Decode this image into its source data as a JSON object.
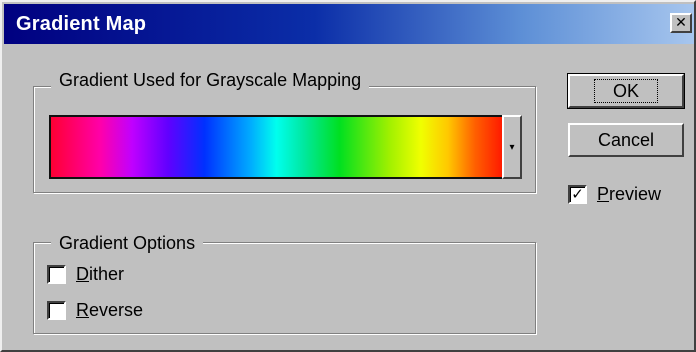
{
  "window": {
    "title": "Gradient Map",
    "close_glyph": "✕"
  },
  "gradient_group": {
    "legend": "Gradient Used for Grayscale Mapping",
    "dropdown_glyph": "▾",
    "gradient_colors": [
      "#ff0033",
      "#ff00aa",
      "#c000ff",
      "#0030ff",
      "#00ffee",
      "#00e020",
      "#f0ff00",
      "#ffc800",
      "#ff1a00"
    ]
  },
  "options_group": {
    "legend": "Gradient Options",
    "dither": {
      "mnemonic": "D",
      "rest": "ither",
      "checked": false
    },
    "reverse": {
      "mnemonic": "R",
      "rest": "everse",
      "checked": false
    }
  },
  "buttons": {
    "ok": "OK",
    "cancel": "Cancel"
  },
  "preview": {
    "mnemonic": "P",
    "rest": "review",
    "checked": true,
    "check_glyph": "✓"
  },
  "icons": {
    "close": "close-icon",
    "dropdown": "chevron-down-icon",
    "check": "checkmark-icon"
  },
  "colors": {
    "face": "#c0c0c0",
    "title_start": "#000080",
    "title_end": "#a7c6ee"
  }
}
